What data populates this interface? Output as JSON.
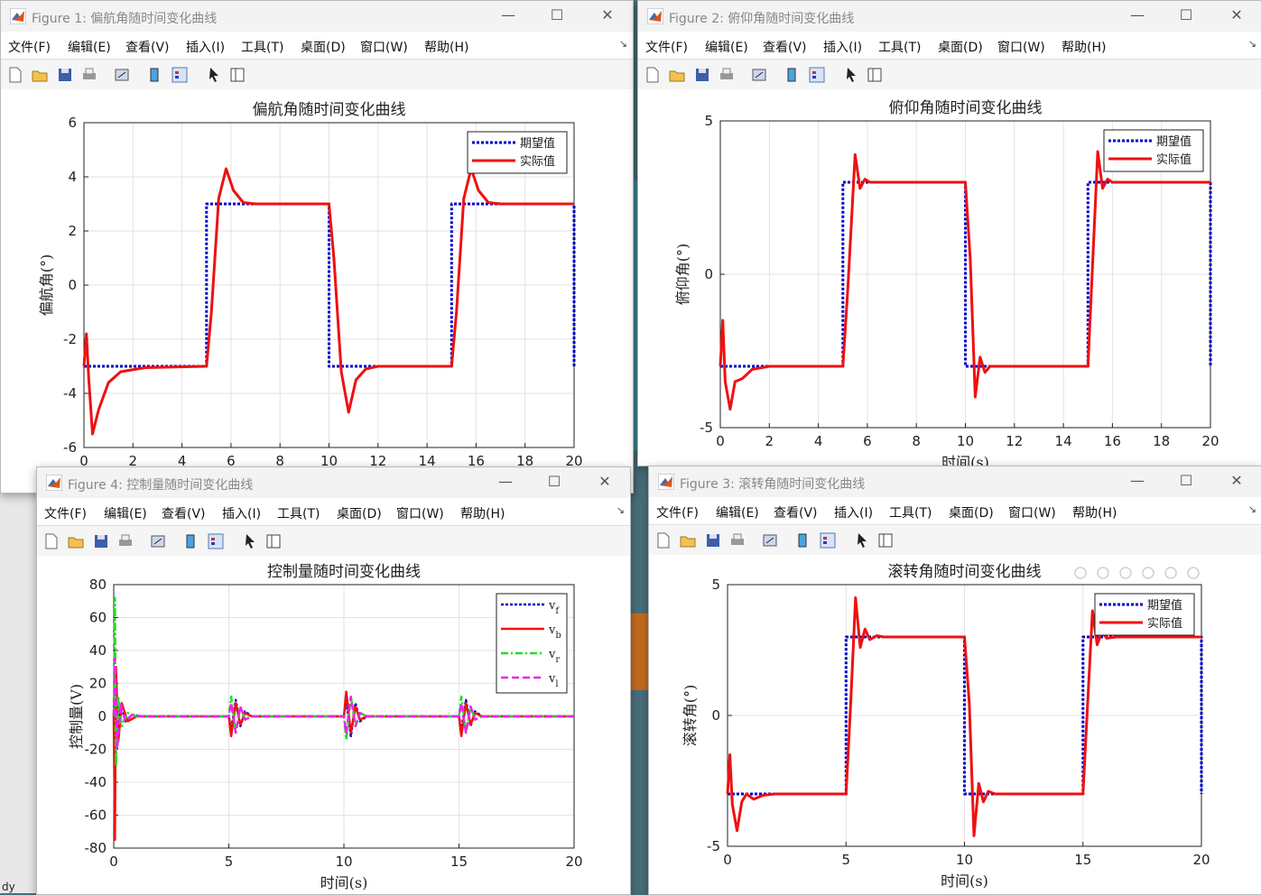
{
  "menu": [
    "文件(F)",
    "编辑(E)",
    "查看(V)",
    "插入(I)",
    "工具(T)",
    "桌面(D)",
    "窗口(W)",
    "帮助(H)"
  ],
  "taskbar": {
    "label": "dy"
  },
  "windows": [
    {
      "id": "fig1",
      "title": "Figure 1: 偏航角随时间变化曲线"
    },
    {
      "id": "fig2",
      "title": "Figure 2: 俯仰角随时间变化曲线"
    },
    {
      "id": "fig4",
      "title": "Figure 4: 控制量随时间变化曲线"
    },
    {
      "id": "fig3",
      "title": "Figure 3: 滚转角随时间变化曲线"
    }
  ],
  "colors": {
    "desired": "#0000cc",
    "actual": "#ee1111",
    "vf": "#0000cc",
    "vb": "#ee1111",
    "vr": "#22dd22",
    "vl": "#ee22ee"
  },
  "chart_data": [
    {
      "type": "line",
      "window": "fig1",
      "title": "偏航角随时间变化曲线",
      "xlabel": "",
      "ylabel": "偏航角(°)",
      "xlim": [
        0,
        20
      ],
      "ylim": [
        -6,
        6
      ],
      "xticks": [
        "0",
        "2",
        "4",
        "6",
        "8",
        "10",
        "12",
        "14",
        "16",
        "18",
        "20"
      ],
      "yticks": [
        "6",
        "4",
        "2",
        "0",
        "-2",
        "-4",
        "-6"
      ],
      "legend": [
        "期望值",
        "实际值"
      ],
      "legend_loc": "top-right",
      "series": [
        {
          "name": "期望值",
          "x": [
            0,
            5,
            5,
            10,
            10,
            15,
            15,
            20,
            20
          ],
          "y": [
            -3,
            -3,
            3,
            3,
            -3,
            -3,
            3,
            3,
            -3
          ]
        },
        {
          "name": "实际值",
          "x": [
            0,
            0.1,
            0.2,
            0.35,
            0.6,
            1,
            1.5,
            2.5,
            5,
            5.2,
            5.5,
            5.8,
            6.1,
            6.5,
            7,
            8,
            10,
            10.2,
            10.5,
            10.8,
            11.1,
            11.5,
            12,
            13,
            15,
            15.2,
            15.5,
            15.8,
            16.1,
            16.5,
            17,
            20
          ],
          "y": [
            -3,
            -1.8,
            -3.5,
            -5.5,
            -4.6,
            -3.6,
            -3.2,
            -3.05,
            -3,
            -1,
            3.2,
            4.3,
            3.5,
            3.05,
            3,
            3,
            3,
            1,
            -3.2,
            -4.7,
            -3.5,
            -3.1,
            -3,
            -3,
            -3,
            -1,
            3.2,
            4.3,
            3.5,
            3.05,
            3,
            3
          ]
        }
      ]
    },
    {
      "type": "line",
      "window": "fig2",
      "title": "俯仰角随时间变化曲线",
      "xlabel": "时间(s)",
      "ylabel": "俯仰角(°)",
      "xlim": [
        0,
        20
      ],
      "ylim": [
        -5,
        5
      ],
      "xticks": [
        "0",
        "2",
        "4",
        "6",
        "8",
        "10",
        "12",
        "14",
        "16",
        "18",
        "20"
      ],
      "yticks": [
        "5",
        "0",
        "-5"
      ],
      "legend": [
        "期望值",
        "实际值"
      ],
      "legend_loc": "top-right",
      "series": [
        {
          "name": "期望值",
          "x": [
            0,
            5,
            5,
            10,
            10,
            15,
            15,
            20,
            20
          ],
          "y": [
            -3,
            -3,
            3,
            3,
            -3,
            -3,
            3,
            3,
            -3
          ]
        },
        {
          "name": "实际值",
          "x": [
            0,
            0.1,
            0.2,
            0.4,
            0.6,
            0.9,
            1.3,
            2,
            5,
            5.2,
            5.5,
            5.7,
            5.9,
            6.1,
            6.5,
            10,
            10.2,
            10.4,
            10.6,
            10.8,
            11,
            11.4,
            15,
            15.2,
            15.4,
            15.6,
            15.8,
            16,
            16.5,
            20
          ],
          "y": [
            -3,
            -1.5,
            -3.5,
            -4.4,
            -3.5,
            -3.4,
            -3.1,
            -3,
            -3,
            -0.5,
            3.9,
            2.8,
            3.1,
            3,
            3,
            3,
            0.5,
            -4,
            -2.7,
            -3.2,
            -3,
            -3,
            -3,
            0.5,
            4,
            2.8,
            3.1,
            3,
            3,
            3
          ]
        }
      ]
    },
    {
      "type": "line",
      "window": "fig4",
      "title": "控制量随时间变化曲线",
      "xlabel": "时间(s)",
      "ylabel": "控制量(V)",
      "xlim": [
        0,
        20
      ],
      "ylim": [
        -80,
        80
      ],
      "xticks": [
        "0",
        "5",
        "10",
        "15",
        "20"
      ],
      "yticks": [
        "80",
        "60",
        "40",
        "20",
        "0",
        "-20",
        "-40",
        "-60",
        "-80"
      ],
      "legend": [
        "v_f",
        "v_b",
        "v_r",
        "v_l"
      ],
      "legend_loc": "top-right",
      "series": [
        {
          "name": "v_f",
          "x": [
            0,
            0.05,
            0.15,
            0.3,
            0.5,
            0.8,
            1.2,
            5,
            5.1,
            5.3,
            5.5,
            5.7,
            6,
            10,
            10.1,
            10.3,
            10.5,
            10.7,
            11,
            15,
            15.1,
            15.3,
            15.5,
            15.7,
            16,
            20
          ],
          "y": [
            0,
            20,
            -10,
            8,
            -3,
            1,
            0,
            0,
            -8,
            10,
            -6,
            3,
            0,
            0,
            10,
            -12,
            8,
            -3,
            0,
            0,
            -8,
            10,
            -6,
            3,
            0,
            0
          ]
        },
        {
          "name": "v_b",
          "x": [
            0,
            0.05,
            0.1,
            0.2,
            0.35,
            0.6,
            1,
            5,
            5.1,
            5.3,
            5.5,
            5.7,
            6,
            10,
            10.1,
            10.3,
            10.5,
            10.7,
            11,
            15,
            15.1,
            15.3,
            15.5,
            15.7,
            16,
            20
          ],
          "y": [
            0,
            -75,
            30,
            -15,
            8,
            -3,
            0,
            0,
            -12,
            8,
            -5,
            2,
            0,
            0,
            15,
            -10,
            6,
            -2,
            0,
            0,
            -12,
            8,
            -5,
            2,
            0,
            0
          ]
        },
        {
          "name": "v_r",
          "x": [
            0,
            0.05,
            0.1,
            0.2,
            0.35,
            0.6,
            1,
            5,
            5.1,
            5.3,
            5.5,
            5.7,
            6,
            10,
            10.1,
            10.3,
            10.5,
            10.7,
            11,
            15,
            15.1,
            15.3,
            15.5,
            15.7,
            16,
            20
          ],
          "y": [
            0,
            72,
            -30,
            12,
            -6,
            2,
            0,
            0,
            12,
            -10,
            6,
            -2,
            0,
            0,
            -14,
            12,
            -6,
            2,
            0,
            0,
            12,
            -10,
            6,
            -2,
            0,
            0
          ]
        },
        {
          "name": "v_l",
          "x": [
            0,
            0.05,
            0.15,
            0.3,
            0.5,
            0.8,
            1.2,
            5,
            5.1,
            5.3,
            5.5,
            5.7,
            6,
            10,
            10.1,
            10.3,
            10.5,
            10.7,
            11,
            15,
            15.1,
            15.3,
            15.5,
            15.7,
            16,
            20
          ],
          "y": [
            0,
            35,
            -20,
            8,
            -3,
            1,
            0,
            0,
            8,
            -10,
            6,
            -2,
            0,
            0,
            -10,
            12,
            -6,
            2,
            0,
            0,
            8,
            -10,
            6,
            -2,
            0,
            0
          ]
        }
      ]
    },
    {
      "type": "line",
      "window": "fig3",
      "title": "滚转角随时间变化曲线",
      "xlabel": "时间(s)",
      "ylabel": "滚转角(°)",
      "xlim": [
        0,
        20
      ],
      "ylim": [
        -5,
        5
      ],
      "xticks": [
        "0",
        "5",
        "10",
        "15",
        "20"
      ],
      "yticks": [
        "5",
        "0",
        "-5"
      ],
      "legend": [
        "期望值",
        "实际值"
      ],
      "legend_loc": "top-right",
      "series": [
        {
          "name": "期望值",
          "x": [
            0,
            5,
            5,
            10,
            10,
            15,
            15,
            20,
            20
          ],
          "y": [
            -3,
            -3,
            3,
            3,
            -3,
            -3,
            3,
            3,
            -3
          ]
        },
        {
          "name": "实际值",
          "x": [
            0,
            0.1,
            0.2,
            0.4,
            0.6,
            0.8,
            1.1,
            1.5,
            2,
            5,
            5.2,
            5.4,
            5.6,
            5.8,
            6,
            6.3,
            6.6,
            10,
            10.2,
            10.4,
            10.6,
            10.8,
            11,
            11.3,
            15,
            15.2,
            15.4,
            15.6,
            15.8,
            16,
            16.4,
            20
          ],
          "y": [
            -3,
            -1.5,
            -3.4,
            -4.4,
            -3.3,
            -3,
            -3.2,
            -3.05,
            -3,
            -3,
            0.5,
            4.5,
            2.6,
            3.3,
            2.9,
            3.05,
            3,
            3,
            0.5,
            -4.6,
            -2.6,
            -3.3,
            -2.9,
            -3,
            -3,
            0.5,
            4,
            2.7,
            3.2,
            2.95,
            3,
            3
          ]
        }
      ]
    }
  ]
}
